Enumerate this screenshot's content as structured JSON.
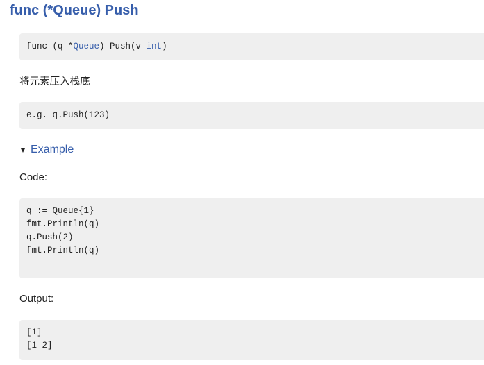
{
  "title": "func (*Queue) Push",
  "signature": {
    "prefix": "func (q *",
    "receiver_type": "Queue",
    "middle": ") Push(v ",
    "param_type": "int",
    "suffix": ")"
  },
  "description": "将元素压入栈底",
  "usage_example": "e.g. q.Push(123)",
  "example": {
    "toggle_icon": "triangle-down-icon",
    "label": "Example",
    "code_label": "Code:",
    "code_lines": [
      "q := Queue{1}",
      "fmt.Println(q)",
      "q.Push(2)",
      "fmt.Println(q)"
    ],
    "output_label": "Output:",
    "output_lines": [
      "[1]",
      "[1 2]"
    ]
  },
  "colors": {
    "link": "#375eab",
    "code_bg": "#efefef",
    "text": "#222222"
  }
}
